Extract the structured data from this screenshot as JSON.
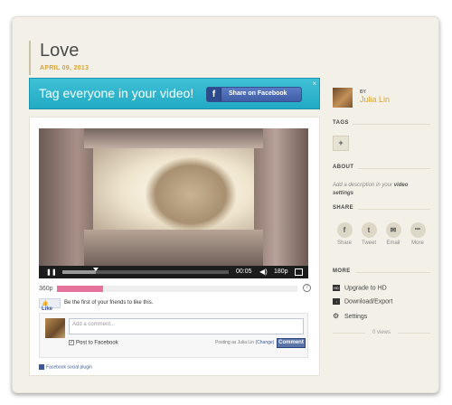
{
  "post": {
    "title": "Love",
    "date": "APRIL 09, 2013"
  },
  "banner": {
    "text": "Tag everyone in your video!",
    "fb_icon": "f",
    "button_label": "Share on Facebook",
    "close": "×"
  },
  "player": {
    "time": "00:05",
    "quality": "180p",
    "progress": 0.2
  },
  "quality_bar": {
    "label": "360p",
    "fill": 0.19,
    "help_icon": "?"
  },
  "facebook": {
    "like_label": "Like",
    "like_text": "Be the first of your friends to like this.",
    "comment_placeholder": "Add a comment...",
    "post_to_facebook": "Post to Facebook",
    "posting_as": "Posting as Julia Lin",
    "change_link": "(Change)",
    "comment_button": "Comment",
    "plugin_label": "Facebook social plugin"
  },
  "sidebar": {
    "by": "BY",
    "user_name": "Julia Lin",
    "tags_heading": "TAGS",
    "add_tag_icon": "+",
    "about_heading": "ABOUT",
    "about_prefix": "Add a description in your",
    "about_bold1": "video",
    "about_bold2": "settings",
    "share_heading": "SHARE",
    "share_items": [
      {
        "label": "Share",
        "glyph": "f"
      },
      {
        "label": "Tweet",
        "glyph": "t"
      },
      {
        "label": "Email",
        "glyph": "✉"
      },
      {
        "label": "More",
        "glyph": "•••"
      }
    ],
    "more_heading": "MORE",
    "more_items": [
      {
        "label": "Upgrade to HD",
        "icon": "HD"
      },
      {
        "label": "Download/Export",
        "icon": "↓"
      },
      {
        "label": "Settings",
        "icon": "⚙"
      }
    ],
    "views": "0 views"
  }
}
